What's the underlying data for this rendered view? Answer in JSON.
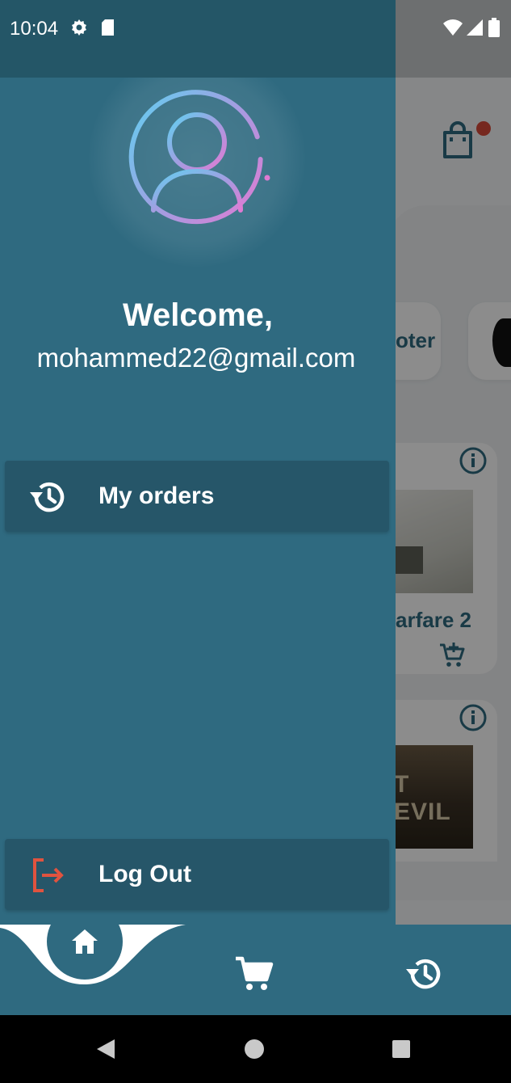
{
  "status_bar": {
    "time": "10:04",
    "icons": [
      "settings-icon",
      "sd-card-icon",
      "wifi-icon",
      "signal-icon",
      "battery-icon"
    ]
  },
  "drawer": {
    "avatar_icon": "user-avatar-icon",
    "welcome": "Welcome,",
    "email": "mohammed22@gmail.com",
    "menu": [
      {
        "label": "My orders",
        "icon": "history-icon"
      },
      {
        "label": "Log Out",
        "icon": "logout-icon"
      }
    ]
  },
  "background_app": {
    "header_icon": "shopping-bag-icon",
    "category_partial": "oter",
    "games": [
      {
        "title_partial": "arfare 2",
        "image_text": "",
        "icons": [
          "info-icon",
          "add-to-cart-icon"
        ]
      },
      {
        "title_partial": "",
        "image_text": "T EVIL",
        "icons": [
          "info-icon"
        ]
      }
    ]
  },
  "bottom_nav": {
    "items": [
      "home-icon",
      "cart-icon",
      "history-icon"
    ],
    "active": "home"
  },
  "colors": {
    "drawer_bg": "#2f6a80",
    "menu_item_bg": "#265669",
    "logout_accent": "#e0533f",
    "avatar_gradient_start": "#5fd0f0",
    "avatar_gradient_end": "#e07ad2"
  }
}
